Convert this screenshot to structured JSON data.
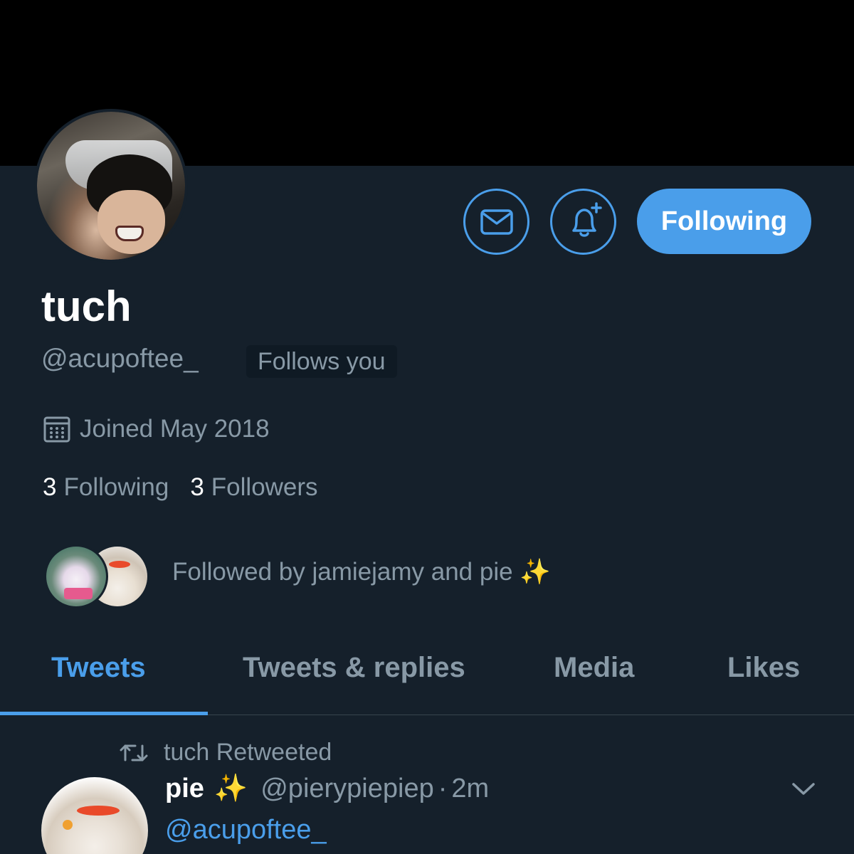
{
  "profile": {
    "display_name": "tuch",
    "handle": "@acupoftee_",
    "follows_you_badge": "Follows you",
    "joined": "Joined May 2018",
    "following_count": "3",
    "following_label": "Following",
    "followers_count": "3",
    "followers_label": "Followers",
    "followed_by": "Followed by jamiejamy and pie",
    "followed_by_emoji": "✨"
  },
  "actions": {
    "message_icon": "envelope-icon",
    "notify_icon": "bell-plus-icon",
    "follow_button_label": "Following"
  },
  "tabs": [
    {
      "label": "Tweets",
      "active": true
    },
    {
      "label": "Tweets & replies",
      "active": false
    },
    {
      "label": "Media",
      "active": false
    },
    {
      "label": "Likes",
      "active": false
    }
  ],
  "tweet": {
    "retweet_label": "tuch Retweeted",
    "author_name": "pie",
    "author_emoji": "✨",
    "author_handle": "@pierypiepiep",
    "separator": "·",
    "time": "2m",
    "body": "@acupoftee_"
  },
  "colors": {
    "background": "#15202b",
    "banner": "#000000",
    "accent": "#4a9eea",
    "secondary_text": "#8899a6"
  }
}
